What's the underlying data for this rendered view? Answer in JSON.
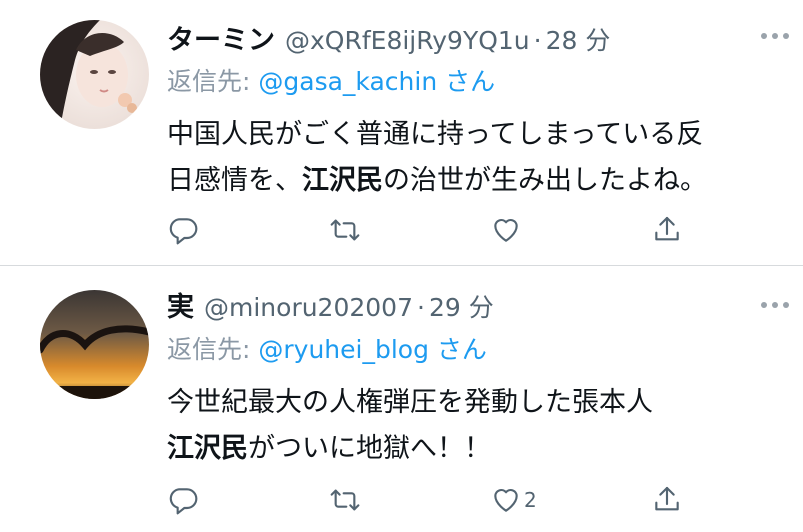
{
  "tweets": [
    {
      "author_name": "ターミン",
      "author_handle": "@xQRfE8ijRy9YQ1u",
      "separator": "·",
      "time": "28 分",
      "reply_prefix": "返信先:",
      "reply_to": "@gasa_kachin",
      "reply_suffix": "さん",
      "text_line1": "中国人民がごく普通に持ってしまっている反",
      "text_line2_a": "日感情を、",
      "text_line2_bold": "江沢民",
      "text_line2_b": "の治世が生み出したよね。",
      "like_count": ""
    },
    {
      "author_name": "実",
      "author_handle": "@minoru202007",
      "separator": "·",
      "time": "29 分",
      "reply_prefix": "返信先:",
      "reply_to": "@ryuhei_blog",
      "reply_suffix": "さん",
      "text_line1": "今世紀最大の人権弾圧を発動した張本人",
      "text_line2_bold": "江沢民",
      "text_line2_b": "がついに地獄へ！！",
      "like_count": "2"
    }
  ],
  "icons": [
    "reply-icon",
    "retweet-icon",
    "like-icon",
    "share-icon",
    "more-icon"
  ],
  "colors": {
    "mention": "#1d9bf0",
    "secondary": "#536471",
    "divider": "#d7dadd"
  }
}
